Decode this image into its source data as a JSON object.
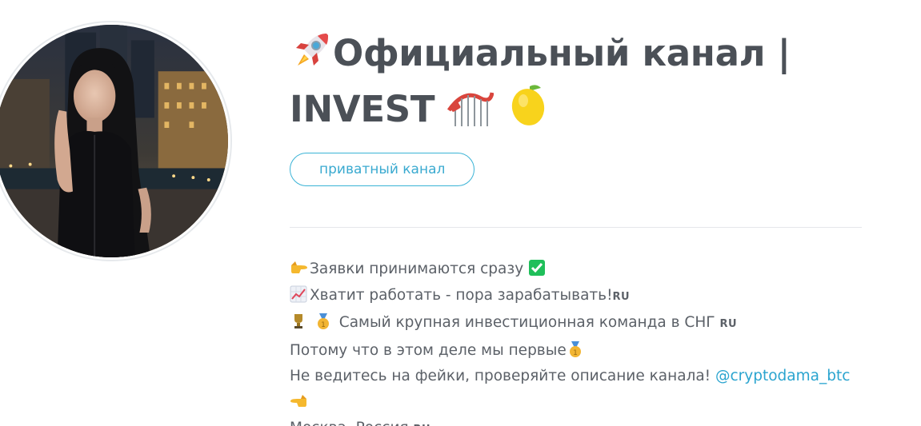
{
  "channel": {
    "title_line1": "Официальный канал |",
    "title_line2": "INVEST",
    "badge": "приватный канал",
    "description": {
      "line1": "Заявки принимаются сразу",
      "line2": "Хватит работать - пора зарабатывать!",
      "line2_flag": "RU",
      "line3": "Самый крупная инвестиционная команда в СНГ",
      "line3_flag": "RU",
      "line4": "Потому что в этом деле мы первые",
      "line5": "Не ведитесь на фейки, проверяйте описание канала! ",
      "mention": "@cryptodama_btc",
      "location": "Москва, Россия",
      "location_flag": "RU"
    }
  },
  "icons": [
    "rocket-icon",
    "roller-coaster-icon",
    "lemon-icon",
    "point-right-icon",
    "check-mark-icon",
    "chart-up-icon",
    "trophy-icon",
    "medal-icon",
    "point-left-icon"
  ],
  "colors": {
    "accent": "#3ab3d6",
    "link": "#2aa4cf",
    "title": "#4b5057",
    "text": "#5c6168"
  }
}
